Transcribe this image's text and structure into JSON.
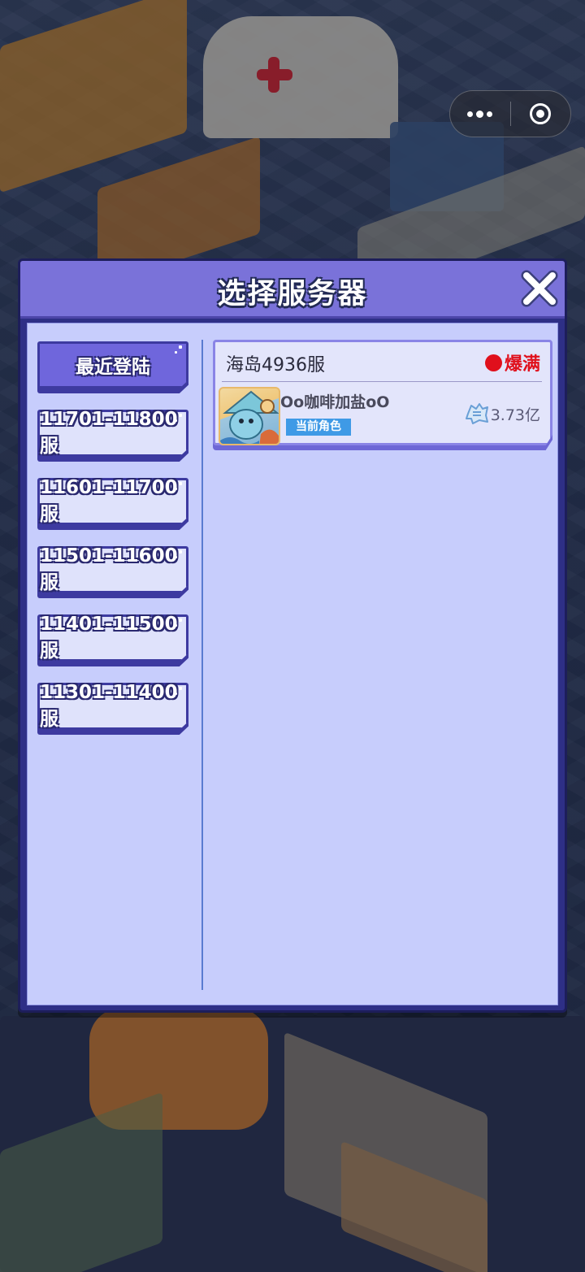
{
  "dialog": {
    "title": "选择服务器",
    "close_icon": "close-x-icon"
  },
  "tabs": [
    {
      "label": "最近登陆",
      "active": true
    },
    {
      "label": "11701-11800服",
      "active": false
    },
    {
      "label": "11601-11700服",
      "active": false
    },
    {
      "label": "11501-11600服",
      "active": false
    },
    {
      "label": "11401-11500服",
      "active": false
    },
    {
      "label": "11301-11400服",
      "active": false
    }
  ],
  "server_card": {
    "server_name": "海岛4936服",
    "status": "爆满",
    "status_color": "#e0101c",
    "player_name": "Oo咖啡加盐oO",
    "role_badge": "当前角色",
    "power_value": "3.73亿",
    "power_icon": "fist-power-icon"
  },
  "capsule": {
    "more_icon": "more-dots-icon",
    "exit_icon": "target-circle-icon"
  },
  "colors": {
    "header": "#7a72d9",
    "body": "#c7cdfc",
    "active_tab": "#6f66dc",
    "badge": "#3f9ae6"
  }
}
